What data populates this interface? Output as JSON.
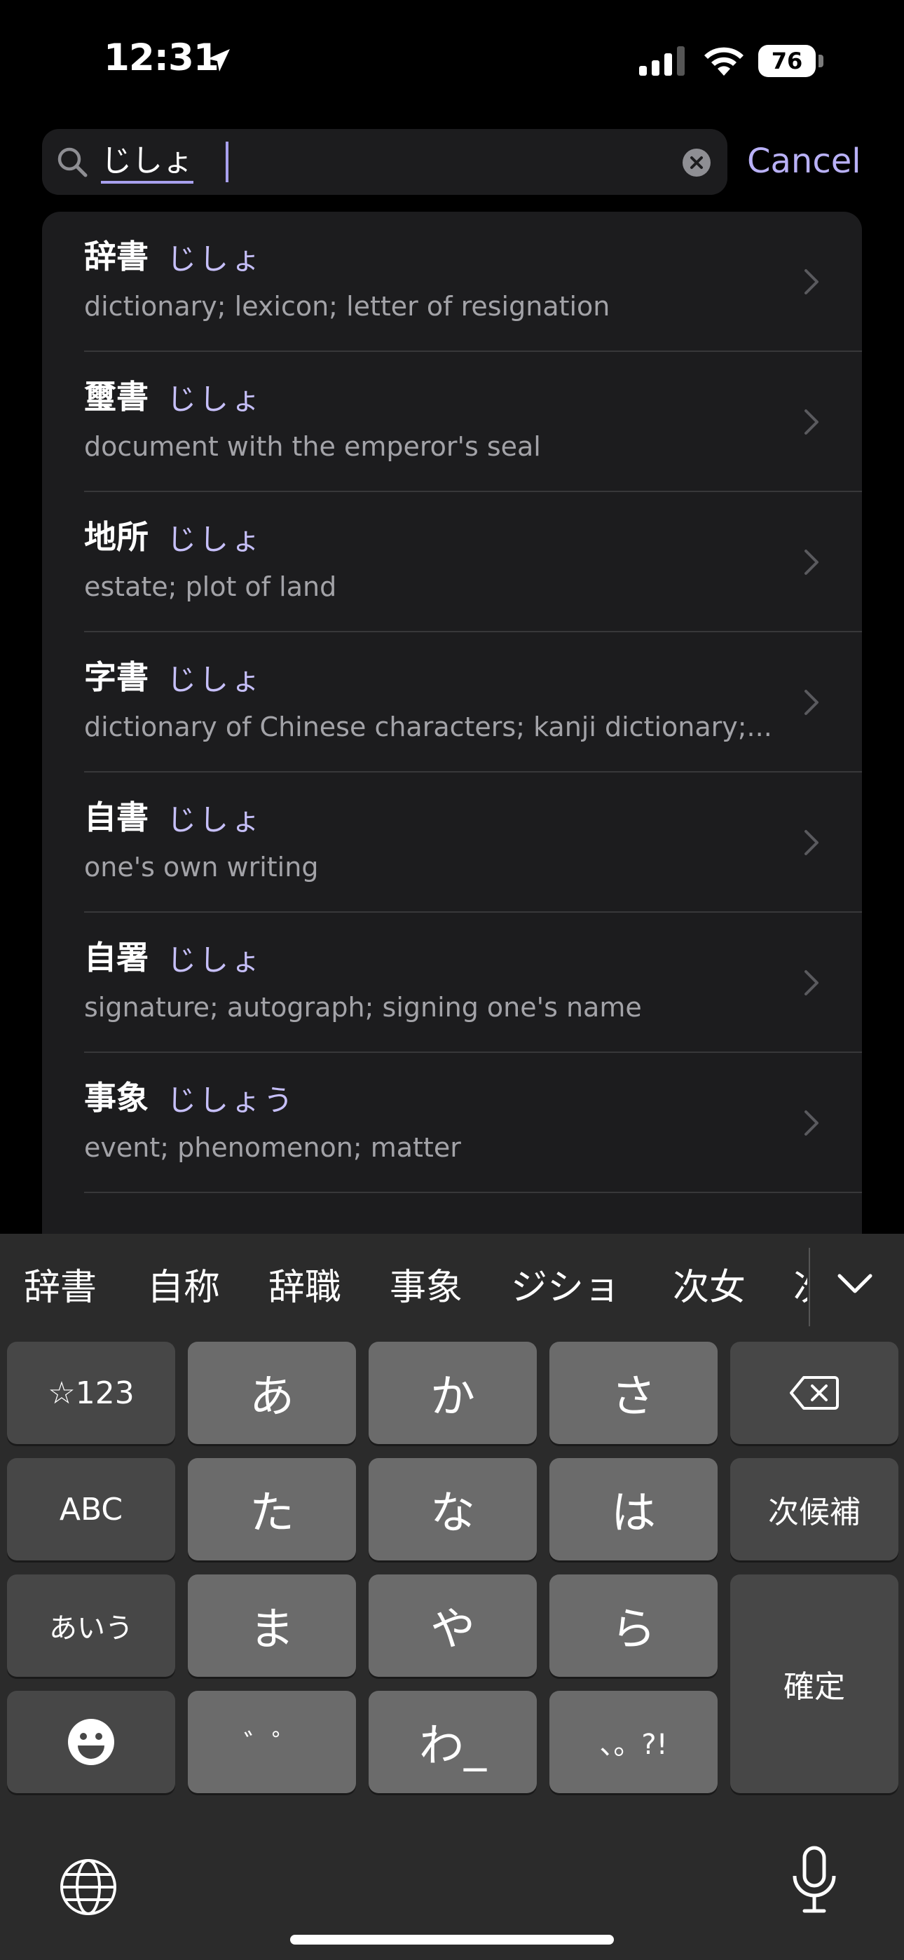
{
  "status_bar": {
    "time": "12:31",
    "battery": "76"
  },
  "search": {
    "query": "じしょ",
    "cancel_label": "Cancel"
  },
  "results": [
    {
      "word": "辞書",
      "reading": "じしょ",
      "meaning": "dictionary; lexicon; letter of resignation"
    },
    {
      "word": "璽書",
      "reading": "じしょ",
      "meaning": "document with the emperor's seal"
    },
    {
      "word": "地所",
      "reading": "じしょ",
      "meaning": "estate; plot of land"
    },
    {
      "word": "字書",
      "reading": "じしょ",
      "meaning": "dictionary of Chinese characters; kanji dictionary;..."
    },
    {
      "word": "自書",
      "reading": "じしょ",
      "meaning": "one's own writing"
    },
    {
      "word": "自署",
      "reading": "じしょ",
      "meaning": "signature; autograph; signing one's name"
    },
    {
      "word": "事象",
      "reading": "じしょう",
      "meaning": "event; phenomenon; matter"
    }
  ],
  "keyboard": {
    "candidates": [
      "辞書",
      "自称",
      "辞職",
      "事象",
      "ジショ",
      "次女",
      "次"
    ],
    "keys": {
      "num": "☆123",
      "a": "あ",
      "ka": "か",
      "sa": "さ",
      "abc": "ABC",
      "ta": "た",
      "na": "な",
      "ha": "は",
      "next_candidate": "次候補",
      "aiu": "あいう",
      "ma": "ま",
      "ya": "や",
      "ra": "ら",
      "confirm": "確定",
      "dakuten": "゛゜",
      "wa": "わ_",
      "punct": "、。?!"
    }
  },
  "colors": {
    "accent": "#b9b1f7",
    "reading": "#c6bff9"
  }
}
